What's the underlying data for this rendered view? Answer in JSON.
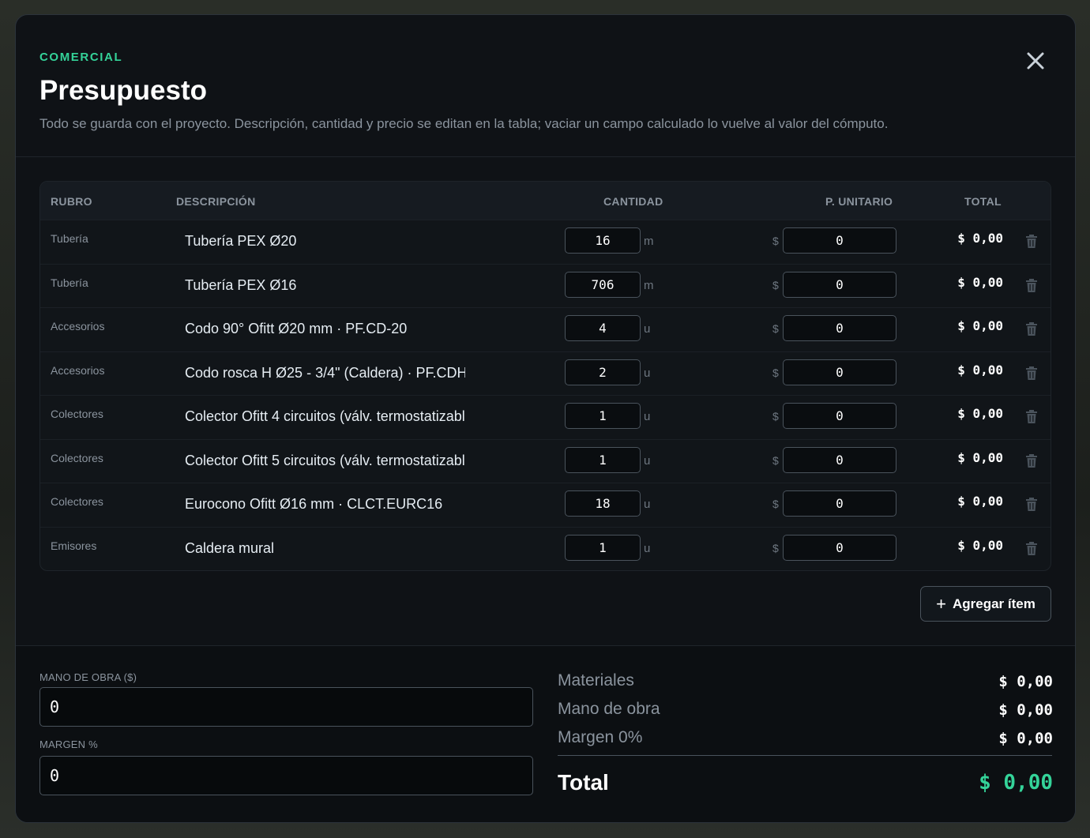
{
  "header": {
    "eyebrow": "COMERCIAL",
    "title": "Presupuesto",
    "subtitle": "Todo se guarda con el proyecto. Descripción, cantidad y precio se editan en la tabla; vaciar un campo calculado lo vuelve al valor del cómputo."
  },
  "table": {
    "columns": {
      "rubro": "RUBRO",
      "descripcion": "DESCRIPCIÓN",
      "cantidad": "CANTIDAD",
      "unitario": "P. UNITARIO",
      "total": "TOTAL"
    },
    "currency_symbol": "$",
    "rows": [
      {
        "rubro": "Tubería",
        "descripcion": "Tubería PEX Ø20",
        "cantidad": "16",
        "unidad": "m",
        "precio": "0",
        "total": "$ 0,00"
      },
      {
        "rubro": "Tubería",
        "descripcion": "Tubería PEX Ø16",
        "cantidad": "706",
        "unidad": "m",
        "precio": "0",
        "total": "$ 0,00"
      },
      {
        "rubro": "Accesorios",
        "descripcion": "Codo 90° Ofitt Ø20 mm · PF.CD-20",
        "cantidad": "4",
        "unidad": "u",
        "precio": "0",
        "total": "$ 0,00"
      },
      {
        "rubro": "Accesorios",
        "descripcion": "Codo rosca H Ø25 - 3/4\" (Caldera) · PF.CDH",
        "cantidad": "2",
        "unidad": "u",
        "precio": "0",
        "total": "$ 0,00"
      },
      {
        "rubro": "Colectores",
        "descripcion": "Colector Ofitt 4 circuitos (válv. termostatizabl",
        "cantidad": "1",
        "unidad": "u",
        "precio": "0",
        "total": "$ 0,00"
      },
      {
        "rubro": "Colectores",
        "descripcion": "Colector Ofitt 5 circuitos (válv. termostatizabl",
        "cantidad": "1",
        "unidad": "u",
        "precio": "0",
        "total": "$ 0,00"
      },
      {
        "rubro": "Colectores",
        "descripcion": "Eurocono Ofitt Ø16 mm · CLCT.EURC16",
        "cantidad": "18",
        "unidad": "u",
        "precio": "0",
        "total": "$ 0,00"
      },
      {
        "rubro": "Emisores",
        "descripcion": "Caldera mural",
        "cantidad": "1",
        "unidad": "u",
        "precio": "0",
        "total": "$ 0,00"
      }
    ]
  },
  "add_item_label": "Agregar ítem",
  "footer": {
    "mano_obra_label": "MANO DE OBRA ($)",
    "mano_obra_value": "0",
    "margen_label": "MARGEN %",
    "margen_value": "0",
    "summary": {
      "materiales_label": "Materiales",
      "materiales_value": "$ 0,00",
      "mano_obra_label": "Mano de obra",
      "mano_obra_value": "$ 0,00",
      "margen_label": "Margen 0%",
      "margen_value": "$ 0,00",
      "total_label": "Total",
      "total_value": "$ 0,00"
    }
  },
  "icons": {
    "close": "close-icon",
    "delete": "trash-icon",
    "add": "plus-icon"
  },
  "colors": {
    "accent": "#34d399",
    "background": "#0f1216",
    "border": "#4a535c"
  }
}
